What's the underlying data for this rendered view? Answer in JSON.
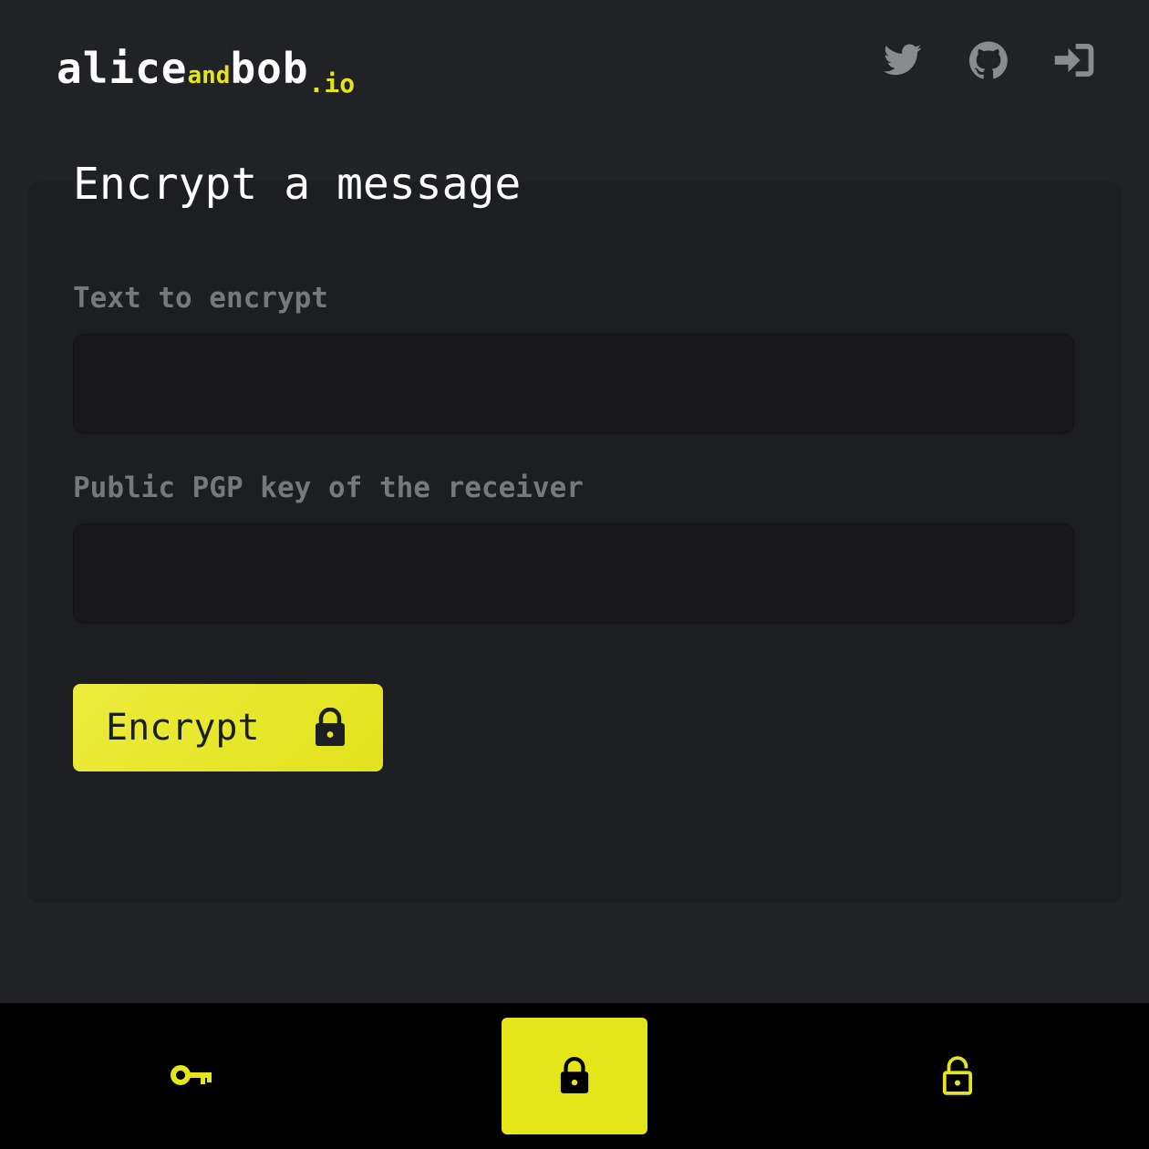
{
  "brand": {
    "part1": "alice",
    "part2": "and",
    "part3": "bob",
    "part4": ".io"
  },
  "header": {
    "icons": [
      "twitter-icon",
      "github-icon",
      "sign-in-icon"
    ]
  },
  "main": {
    "title": "Encrypt a message",
    "text_label": "Text to encrypt",
    "text_value": "",
    "key_label": "Public PGP key of the receiver",
    "key_value": "",
    "button_label": "Encrypt",
    "button_icon": "lock-icon"
  },
  "bottom_nav": {
    "items": [
      {
        "icon": "key-icon",
        "active": false
      },
      {
        "icon": "lock-icon",
        "active": true
      },
      {
        "icon": "unlock-icon",
        "active": false
      }
    ]
  },
  "colors": {
    "accent": "#e5e619",
    "background": "#212226",
    "card": "#1d1e21",
    "nav_background": "#000000"
  }
}
